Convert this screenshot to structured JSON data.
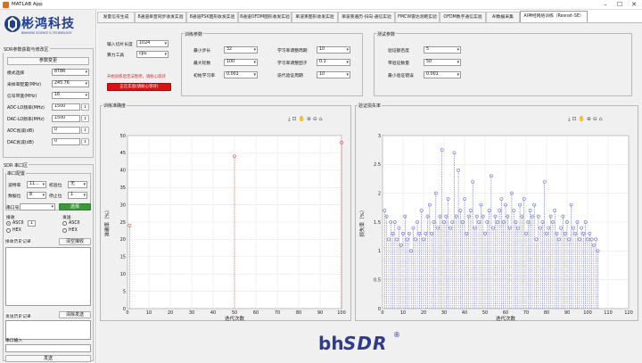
{
  "window": {
    "title": "MATLAB App"
  },
  "brand": {
    "name": "彬鸿科技",
    "tagline": "BINHONG SCIENCE & TECHNOLOGY",
    "footer_logo_main": "bh",
    "footer_logo_accent": "SDR"
  },
  "left": {
    "config_panel": {
      "title": "SDR参数获取与修改区",
      "button": "参数变更",
      "fields": [
        {
          "label": "模式选择",
          "value": "8T8R",
          "type": "select"
        },
        {
          "label": "采样率配置(MHz)",
          "value": "245.76",
          "type": "select"
        },
        {
          "label": "信号带宽(MHz)",
          "value": "16",
          "type": "select"
        },
        {
          "label": "ADC-LO频率(MHz)",
          "value": "1500",
          "type": "stepper"
        },
        {
          "label": "DAC-LO频率(MHz)",
          "value": "1500",
          "type": "stepper"
        },
        {
          "label": "ADC衰减(dB)",
          "value": "0",
          "type": "stepper"
        },
        {
          "label": "DAC衰减(dB)",
          "value": "0",
          "type": "stepper"
        }
      ]
    },
    "serial_panel": {
      "title": "SDR 串口区",
      "config_title": "串口配置",
      "baud_label": "波特率",
      "baud_value": "11...",
      "parity_label": "校验位",
      "parity_value": "无",
      "databits_label": "数据位",
      "databits_value": "8",
      "stopbits_label": "停止位",
      "stopbits_value": "1",
      "port_label": "串口号",
      "open_button": "选择",
      "receive_label": "接收",
      "send_label": "发送",
      "rx_ascii": "ASCII",
      "rx_hex": "HEX",
      "rx_count": "1",
      "tx_ascii": "ASCII",
      "tx_hex": "HEX",
      "rx_history_label": "接收历史记录",
      "clear_rx_button": "清空接收",
      "tx_history_label": "发送历史记录",
      "clear_tx_button": "清除发送",
      "input_label": "串口输入",
      "send_button": "发送"
    }
  },
  "tabs": [
    {
      "label": "发量信号生成"
    },
    {
      "label": "8通道单音同步收发实验"
    },
    {
      "label": "8通道PSK图形收发实验"
    },
    {
      "label": "8通道OFDM图形收发实验"
    },
    {
      "label": "单波束图形收发实验"
    },
    {
      "label": "单波束遍历·扫向·通信实验"
    },
    {
      "label": "FMCW雷达测距实验"
    },
    {
      "label": "OFDM数字通信实验"
    },
    {
      "label": "AI数据采集"
    },
    {
      "label": "AI神经网络训练（Resnet-SE）"
    }
  ],
  "ai_panel": {
    "input_length_label": "输入切片长度",
    "input_length_value": "1024",
    "tool_label": "算力工具",
    "tool_value": "cpu",
    "hint": "开始训练后无法暂停，请耐心等待",
    "train_button": "正在实验(请耐心等待)"
  },
  "train_params": {
    "title": "训练参数",
    "left": [
      {
        "label": "最小步长",
        "value": "32"
      },
      {
        "label": "最大轮数",
        "value": "100"
      },
      {
        "label": "初始学习率",
        "value": "0.001"
      }
    ],
    "right": [
      {
        "label": "学习率调整周期",
        "value": "10"
      },
      {
        "label": "学习率调整因子",
        "value": "0.1"
      },
      {
        "label": "迭代验证周期",
        "value": "10"
      }
    ]
  },
  "test_params": {
    "title": "测试参数",
    "fields": [
      {
        "label": "验证额百度",
        "value": "5"
      },
      {
        "label": "带验证数量",
        "value": "50"
      },
      {
        "label": "最小验证错误",
        "value": "0.001"
      }
    ]
  },
  "chart_data": [
    {
      "type": "scatter",
      "panel_title": "训练准确度",
      "xlabel": "迭代次数",
      "ylabel": "准确率（%）",
      "xlim": [
        0,
        100
      ],
      "ylim": [
        0,
        50
      ],
      "xticks": [
        0,
        10,
        20,
        30,
        40,
        50,
        60,
        70,
        80,
        90,
        100
      ],
      "yticks": [
        0,
        5,
        10,
        15,
        20,
        25,
        30,
        35,
        40,
        45,
        50
      ],
      "x": [
        1,
        50,
        100
      ],
      "y": [
        24,
        44,
        48
      ],
      "color": "#d9534f",
      "grid": true
    },
    {
      "type": "scatter",
      "panel_title": "验证损失率",
      "xlabel": "迭代次数",
      "ylabel": "损失率（%）",
      "xlim": [
        0,
        120
      ],
      "ylim": [
        0,
        3
      ],
      "xticks": [
        0,
        10,
        20,
        30,
        40,
        50,
        60,
        70,
        80,
        90,
        100,
        110,
        120
      ],
      "yticks": [
        0,
        0.5,
        1,
        1.5,
        2,
        2.5,
        3
      ],
      "x": [
        1,
        2,
        3,
        4,
        5,
        6,
        7,
        8,
        9,
        10,
        11,
        12,
        13,
        14,
        15,
        16,
        17,
        18,
        19,
        20,
        21,
        22,
        23,
        24,
        25,
        26,
        27,
        28,
        29,
        30,
        31,
        32,
        33,
        34,
        35,
        36,
        37,
        38,
        39,
        40,
        41,
        42,
        43,
        44,
        45,
        46,
        47,
        48,
        49,
        50,
        51,
        52,
        53,
        54,
        55,
        56,
        57,
        58,
        59,
        60,
        61,
        62,
        63,
        64,
        65,
        66,
        67,
        68,
        69,
        70,
        71,
        72,
        73,
        74,
        75,
        76,
        77,
        78,
        79,
        80,
        81,
        82,
        83,
        84,
        85,
        86,
        87,
        88,
        89,
        90,
        91,
        92,
        93,
        94,
        95,
        96,
        97,
        98,
        99,
        100,
        101,
        102,
        103,
        104,
        105
      ],
      "y": [
        1.7,
        1.6,
        1.2,
        1.5,
        1.3,
        1.5,
        1.2,
        1.4,
        1.1,
        1.3,
        1.6,
        1.2,
        1.3,
        1.0,
        1.4,
        1.2,
        1.5,
        1.3,
        1.7,
        1.2,
        1.3,
        1.6,
        1.8,
        1.3,
        1.5,
        2.0,
        1.4,
        1.6,
        2.75,
        1.5,
        1.6,
        1.9,
        1.4,
        1.5,
        2.7,
        1.6,
        2.4,
        1.7,
        1.5,
        1.9,
        1.3,
        1.6,
        1.7,
        2.2,
        1.4,
        1.6,
        1.5,
        1.8,
        1.6,
        1.3,
        1.5,
        1.7,
        2.3,
        1.4,
        1.6,
        1.5,
        1.7,
        1.9,
        1.5,
        1.8,
        1.6,
        1.4,
        2.0,
        1.7,
        1.5,
        1.4,
        1.8,
        1.6,
        1.9,
        1.3,
        1.5,
        1.7,
        1.6,
        1.8,
        1.2,
        1.6,
        1.4,
        1.5,
        2.2,
        1.3,
        1.4,
        1.6,
        1.5,
        1.7,
        1.3,
        1.2,
        1.4,
        1.6,
        1.3,
        1.5,
        1.2,
        1.8,
        1.4,
        1.3,
        1.5,
        1.2,
        1.4,
        1.3,
        1.5,
        1.2,
        1.3,
        1.2,
        1.1,
        1.2,
        1.0
      ],
      "color": "#6b6bd6",
      "grid": true
    }
  ]
}
